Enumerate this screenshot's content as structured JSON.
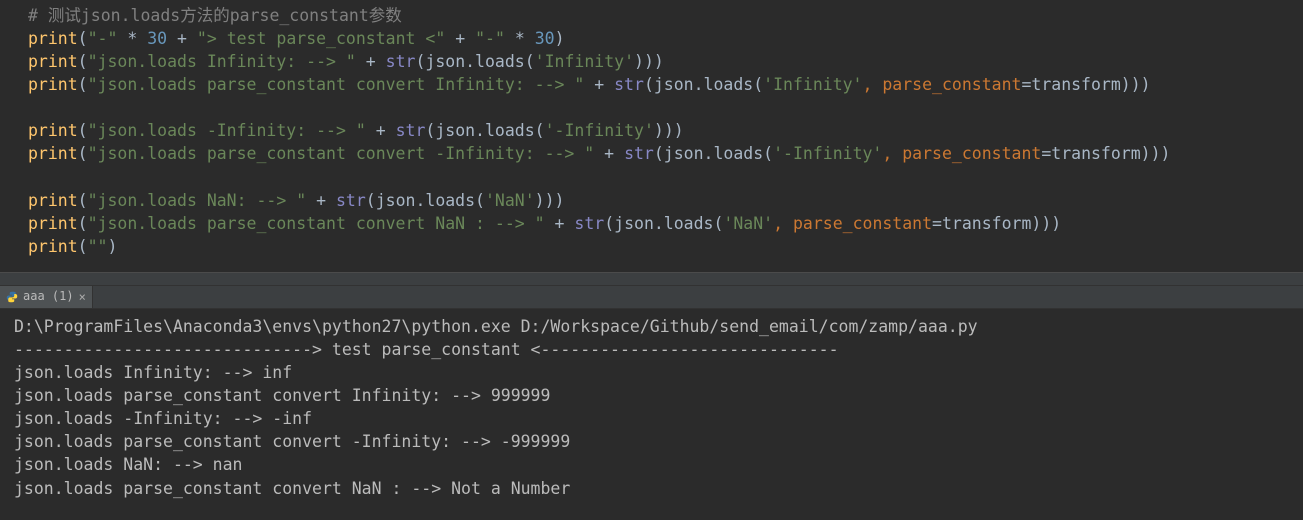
{
  "editor": {
    "lines": [
      {
        "type": "comment",
        "text": "# 测试json.loads方法的parse_constant参数"
      },
      {
        "type": "print",
        "tokens": [
          {
            "t": "fn",
            "v": "print"
          },
          {
            "t": "op",
            "v": "("
          },
          {
            "t": "s",
            "v": "\"-\""
          },
          {
            "t": "op",
            "v": " * "
          },
          {
            "t": "n",
            "v": "30"
          },
          {
            "t": "op",
            "v": " + "
          },
          {
            "t": "s",
            "v": "\"> test parse_constant <\""
          },
          {
            "t": "op",
            "v": " + "
          },
          {
            "t": "s",
            "v": "\"-\""
          },
          {
            "t": "op",
            "v": " * "
          },
          {
            "t": "n",
            "v": "30"
          },
          {
            "t": "op",
            "v": ")"
          }
        ]
      },
      {
        "type": "print",
        "tokens": [
          {
            "t": "fn",
            "v": "print"
          },
          {
            "t": "op",
            "v": "("
          },
          {
            "t": "s",
            "v": "\"json.loads Infinity: --> \""
          },
          {
            "t": "op",
            "v": " + "
          },
          {
            "t": "bi",
            "v": "str"
          },
          {
            "t": "op",
            "v": "(json.loads("
          },
          {
            "t": "s",
            "v": "'Infinity'"
          },
          {
            "t": "op",
            "v": ")))"
          }
        ]
      },
      {
        "type": "print",
        "tokens": [
          {
            "t": "fn",
            "v": "print"
          },
          {
            "t": "op",
            "v": "("
          },
          {
            "t": "s",
            "v": "\"json.loads parse_constant convert Infinity: --> \""
          },
          {
            "t": "op",
            "v": " + "
          },
          {
            "t": "bi",
            "v": "str"
          },
          {
            "t": "op",
            "v": "(json.loads("
          },
          {
            "t": "s",
            "v": "'Infinity'"
          },
          {
            "t": "comma",
            "v": ", "
          },
          {
            "t": "kw",
            "v": "parse_constant"
          },
          {
            "t": "op",
            "v": "=transform)))"
          }
        ]
      },
      {
        "type": "blank"
      },
      {
        "type": "print",
        "tokens": [
          {
            "t": "fn",
            "v": "print"
          },
          {
            "t": "op",
            "v": "("
          },
          {
            "t": "s",
            "v": "\"json.loads -Infinity: --> \""
          },
          {
            "t": "op",
            "v": " + "
          },
          {
            "t": "bi",
            "v": "str"
          },
          {
            "t": "op",
            "v": "(json.loads("
          },
          {
            "t": "s",
            "v": "'-Infinity'"
          },
          {
            "t": "op",
            "v": ")))"
          }
        ]
      },
      {
        "type": "print",
        "tokens": [
          {
            "t": "fn",
            "v": "print"
          },
          {
            "t": "op",
            "v": "("
          },
          {
            "t": "s",
            "v": "\"json.loads parse_constant convert -Infinity: --> \""
          },
          {
            "t": "op",
            "v": " + "
          },
          {
            "t": "bi",
            "v": "str"
          },
          {
            "t": "op",
            "v": "(json.loads("
          },
          {
            "t": "s",
            "v": "'-Infinity'"
          },
          {
            "t": "comma",
            "v": ", "
          },
          {
            "t": "kw",
            "v": "parse_constant"
          },
          {
            "t": "op",
            "v": "=transform)))"
          }
        ]
      },
      {
        "type": "blank"
      },
      {
        "type": "print",
        "tokens": [
          {
            "t": "fn",
            "v": "print"
          },
          {
            "t": "op",
            "v": "("
          },
          {
            "t": "s",
            "v": "\"json.loads NaN: --> \""
          },
          {
            "t": "op",
            "v": " + "
          },
          {
            "t": "bi",
            "v": "str"
          },
          {
            "t": "op",
            "v": "(json.loads("
          },
          {
            "t": "s",
            "v": "'NaN'"
          },
          {
            "t": "op",
            "v": ")))"
          }
        ]
      },
      {
        "type": "print",
        "tokens": [
          {
            "t": "fn",
            "v": "print"
          },
          {
            "t": "op",
            "v": "("
          },
          {
            "t": "s",
            "v": "\"json.loads parse_constant convert NaN : --> \""
          },
          {
            "t": "op",
            "v": " + "
          },
          {
            "t": "bi",
            "v": "str"
          },
          {
            "t": "op",
            "v": "(json.loads("
          },
          {
            "t": "s",
            "v": "'NaN'"
          },
          {
            "t": "comma",
            "v": ", "
          },
          {
            "t": "kw",
            "v": "parse_constant"
          },
          {
            "t": "op",
            "v": "=transform)))"
          }
        ]
      },
      {
        "type": "print",
        "tokens": [
          {
            "t": "fn",
            "v": "print"
          },
          {
            "t": "op",
            "v": "("
          },
          {
            "t": "s",
            "v": "\"\""
          },
          {
            "t": "op",
            "v": ")"
          }
        ]
      }
    ]
  },
  "tab": {
    "label": "aaa (1)",
    "close_glyph": "×"
  },
  "console": {
    "lines": [
      "D:\\ProgramFiles\\Anaconda3\\envs\\python27\\python.exe D:/Workspace/Github/send_email/com/zamp/aaa.py",
      "------------------------------> test parse_constant <------------------------------",
      "json.loads Infinity: --> inf",
      "json.loads parse_constant convert Infinity: --> 999999",
      "json.loads -Infinity: --> -inf",
      "json.loads parse_constant convert -Infinity: --> -999999",
      "json.loads NaN: --> nan",
      "json.loads parse_constant convert NaN : --> Not a Number"
    ]
  }
}
